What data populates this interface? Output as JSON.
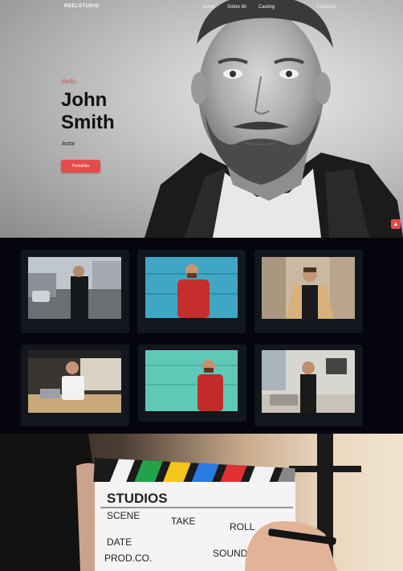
{
  "nav": {
    "logo": "REELSTUDIO",
    "links": [
      "Home",
      "Sobre Mi",
      "Casting",
      "Contacto"
    ]
  },
  "hero": {
    "greeting": "Hello",
    "first_name": "John",
    "last_name": "Smith",
    "role": "Actor",
    "button_label": "Portafolio",
    "scroll_top_icon": "arrow-up-icon"
  },
  "gallery": {
    "items": [
      {
        "label": "photo-1"
      },
      {
        "label": "photo-2"
      },
      {
        "label": "photo-3"
      },
      {
        "label": "photo-4"
      },
      {
        "label": "photo-5"
      },
      {
        "label": "photo-6"
      }
    ]
  },
  "clapperboard": {
    "title": "STUDIOS",
    "fields": [
      "SCENE",
      "TAKE",
      "ROLL",
      "DATE",
      "SOUND",
      "PROD.CO."
    ]
  },
  "colors": {
    "accent": "#e74a4a",
    "gallery_bg": "#05060d",
    "card_bg": "#14161d"
  }
}
